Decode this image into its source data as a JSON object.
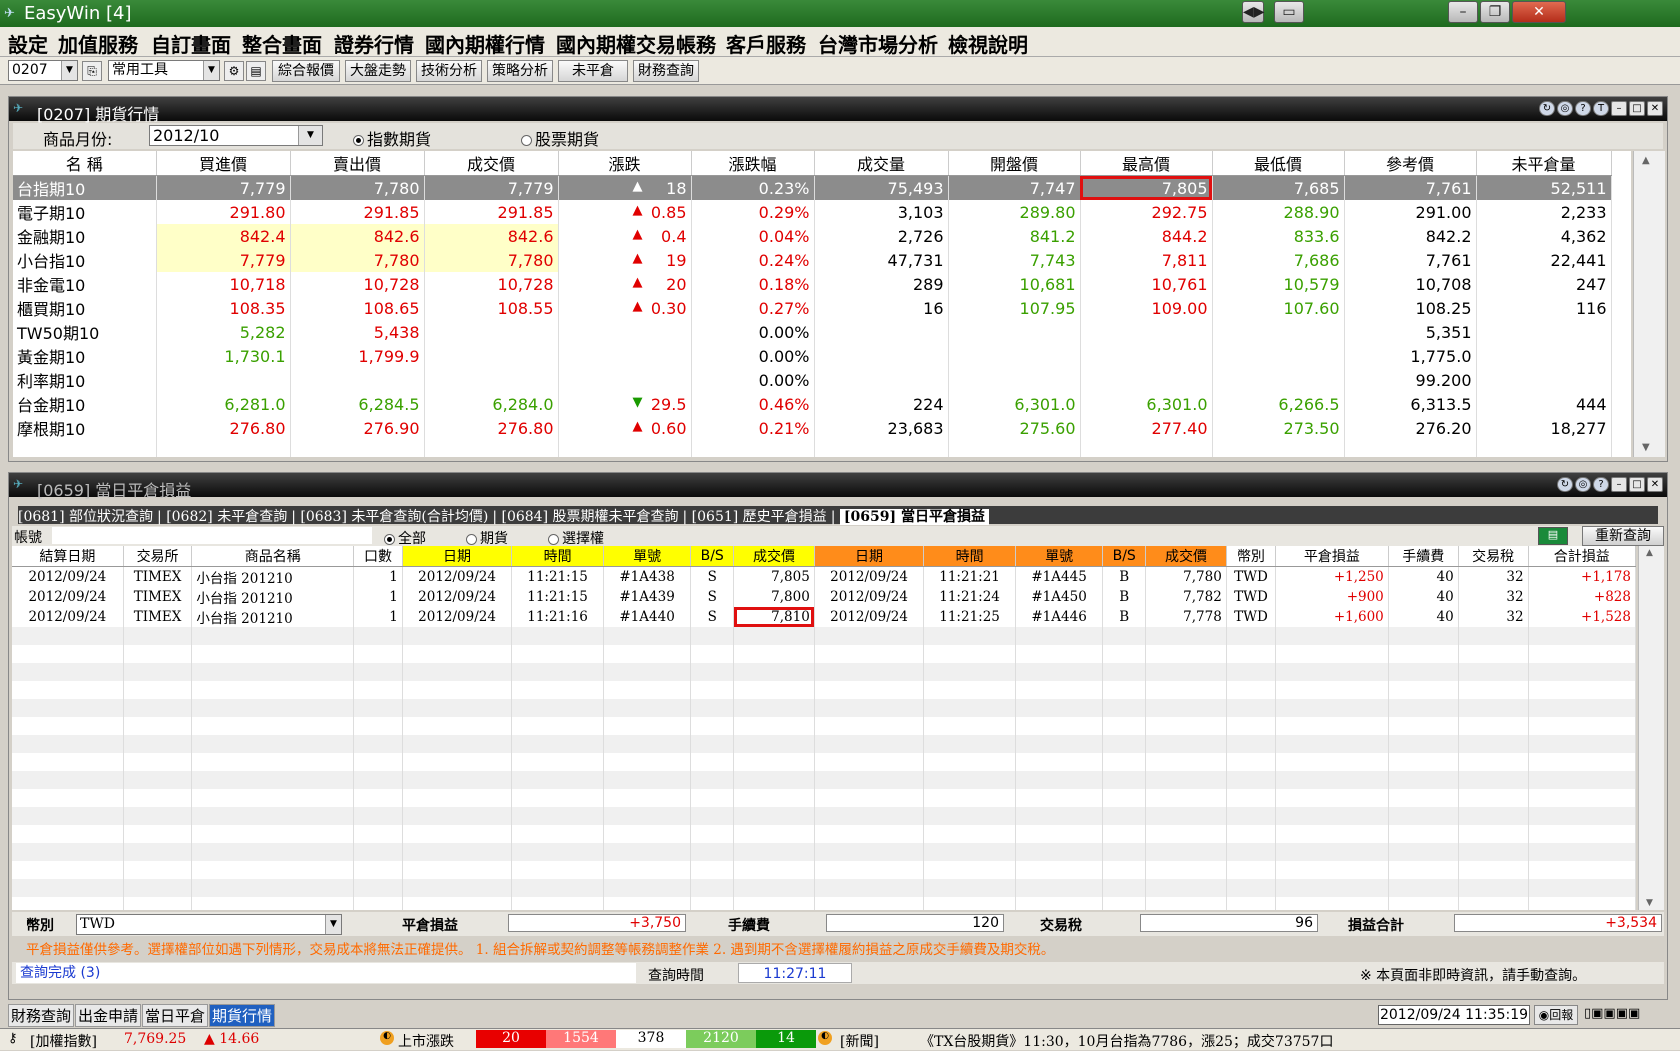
{
  "window": {
    "title": "EasyWin  [4]"
  },
  "menu": [
    "設定",
    "加值服務",
    "自訂畫面",
    "整合畫面",
    "證券行情",
    "國內期權行情",
    "國內期權交易帳務",
    "客戶服務",
    "台灣市場分析",
    "檢視說明"
  ],
  "toolbar": {
    "code": "0207",
    "tools": "常用工具",
    "buttons": [
      "綜合報價",
      "大盤走勢",
      "技術分析",
      "策略分析",
      "未平倉",
      "財務查詢"
    ]
  },
  "quote_panel": {
    "title": "[0207] 期貨行情",
    "month_label": "商品月份:",
    "month_value": "2012/10",
    "radio_index": "指數期貨",
    "radio_stock": "股票期貨",
    "columns": [
      "名 稱",
      "買進價",
      "賣出價",
      "成交價",
      "漲跌",
      "漲跌幅",
      "成交量",
      "開盤價",
      "最高價",
      "最低價",
      "參考價",
      "未平倉量"
    ],
    "rows": [
      {
        "n": "台指期10",
        "bid": "7,779",
        "ask": "7,780",
        "last": "7,779",
        "chg": "18",
        "pct": "0.23%",
        "vol": "75,493",
        "open": "7,747",
        "high": "7,805",
        "low": "7,685",
        "ref": "7,761",
        "oi": "52,511",
        "arrow": "▲"
      },
      {
        "n": "電子期10",
        "bid": "291.80",
        "ask": "291.85",
        "last": "291.85",
        "chg": "0.85",
        "pct": "0.29%",
        "vol": "3,103",
        "open": "289.80",
        "high": "292.75",
        "low": "288.90",
        "ref": "291.00",
        "oi": "2,233",
        "arrow": "▲"
      },
      {
        "n": "金融期10",
        "bid": "842.4",
        "ask": "842.6",
        "last": "842.6",
        "chg": "0.4",
        "pct": "0.04%",
        "vol": "2,726",
        "open": "841.2",
        "high": "844.2",
        "low": "833.6",
        "ref": "842.2",
        "oi": "4,362",
        "arrow": "▲"
      },
      {
        "n": "小台指10",
        "bid": "7,779",
        "ask": "7,780",
        "last": "7,780",
        "chg": "19",
        "pct": "0.24%",
        "vol": "47,731",
        "open": "7,743",
        "high": "7,811",
        "low": "7,686",
        "ref": "7,761",
        "oi": "22,441",
        "arrow": "▲"
      },
      {
        "n": "非金電10",
        "bid": "10,718",
        "ask": "10,728",
        "last": "10,728",
        "chg": "20",
        "pct": "0.18%",
        "vol": "289",
        "open": "10,681",
        "high": "10,761",
        "low": "10,579",
        "ref": "10,708",
        "oi": "247",
        "arrow": "▲"
      },
      {
        "n": "櫃買期10",
        "bid": "108.35",
        "ask": "108.65",
        "last": "108.55",
        "chg": "0.30",
        "pct": "0.27%",
        "vol": "16",
        "open": "107.95",
        "high": "109.00",
        "low": "107.60",
        "ref": "108.25",
        "oi": "116",
        "arrow": "▲"
      },
      {
        "n": "TW50期10",
        "bid": "5,282",
        "ask": "5,438",
        "last": "",
        "chg": "",
        "pct": "0.00%",
        "vol": "",
        "open": "",
        "high": "",
        "low": "",
        "ref": "5,351",
        "oi": "",
        "arrow": ""
      },
      {
        "n": "黃金期10",
        "bid": "1,730.1",
        "ask": "1,799.9",
        "last": "",
        "chg": "",
        "pct": "0.00%",
        "vol": "",
        "open": "",
        "high": "",
        "low": "",
        "ref": "1,775.0",
        "oi": "",
        "arrow": ""
      },
      {
        "n": "利率期10",
        "bid": "",
        "ask": "",
        "last": "",
        "chg": "",
        "pct": "0.00%",
        "vol": "",
        "open": "",
        "high": "",
        "low": "",
        "ref": "99.200",
        "oi": "",
        "arrow": ""
      },
      {
        "n": "台金期10",
        "bid": "6,281.0",
        "ask": "6,284.5",
        "last": "6,284.0",
        "chg": "29.5",
        "pct": "0.46%",
        "vol": "224",
        "open": "6,301.0",
        "high": "6,301.0",
        "low": "6,266.5",
        "ref": "6,313.5",
        "oi": "444",
        "arrow": "▼"
      },
      {
        "n": "摩根期10",
        "bid": "276.80",
        "ask": "276.90",
        "last": "276.80",
        "chg": "0.60",
        "pct": "0.21%",
        "vol": "23,683",
        "open": "275.60",
        "high": "277.40",
        "low": "273.50",
        "ref": "276.20",
        "oi": "18,277",
        "arrow": "▲"
      }
    ]
  },
  "pnl_panel": {
    "title": "[0659] 當日平倉損益",
    "tabs": [
      "[0681] 部位狀況查詢",
      "[0682] 未平倉查詢",
      "[0683] 未平倉查詢(合計均價)",
      "[0684] 股票期權未平倉查詢",
      "[0651] 歷史平倉損益",
      "[0659] 當日平倉損益"
    ],
    "account_label": "帳號",
    "radios": [
      "全部",
      "期貨",
      "選擇權"
    ],
    "requery": "重新查詢",
    "columns": [
      "結算日期",
      "交易所",
      "商品名稱",
      "口數",
      "日期",
      "時間",
      "單號",
      "B/S",
      "成交價",
      "日期",
      "時間",
      "單號",
      "B/S",
      "成交價",
      "幣別",
      "平倉損益",
      "手續費",
      "交易稅",
      "合計損益"
    ],
    "rows": [
      [
        "2012/09/24",
        "TIMEX",
        "小台指 201210",
        "1",
        "2012/09/24",
        "11:21:15",
        "#1A438",
        "S",
        "7,805",
        "2012/09/24",
        "11:21:21",
        "#1A445",
        "B",
        "7,780",
        "TWD",
        "+1,250",
        "40",
        "32",
        "+1,178"
      ],
      [
        "2012/09/24",
        "TIMEX",
        "小台指 201210",
        "1",
        "2012/09/24",
        "11:21:15",
        "#1A439",
        "S",
        "7,800",
        "2012/09/24",
        "11:21:24",
        "#1A450",
        "B",
        "7,782",
        "TWD",
        "+900",
        "40",
        "32",
        "+828"
      ],
      [
        "2012/09/24",
        "TIMEX",
        "小台指 201210",
        "1",
        "2012/09/24",
        "11:21:16",
        "#1A440",
        "S",
        "7,810",
        "2012/09/24",
        "11:21:25",
        "#1A446",
        "B",
        "7,778",
        "TWD",
        "+1,600",
        "40",
        "32",
        "+1,528"
      ]
    ],
    "currency_label": "幣別",
    "currency_value": "TWD",
    "sum_pnl_label": "平倉損益",
    "sum_pnl": "+3,750",
    "fee_label": "手續費",
    "fee": "120",
    "tax_label": "交易稅",
    "tax": "96",
    "total_label": "損益合計",
    "total": "+3,534",
    "notice": "平倉損益僅供參考。選擇權部位如遇下列情形，交易成本將無法正確提供。  1. 組合拆解或契約調整等帳務調整作業  2. 遇到期不含選擇權履約損益之原成交手續費及期交稅。",
    "status": "查詢完成 (3)",
    "query_time_label": "查詢時間",
    "query_time": "11:27:11",
    "realtime_note": "※ 本頁面非即時資訊，請手動查詢。"
  },
  "bottom_tabs": [
    "財務查詢",
    "出金申請",
    "當日平倉",
    "期貨行情"
  ],
  "datetime": "2012/09/24 11:35:19",
  "back_label": "回報",
  "status": {
    "index_label": "[加權指數]",
    "index_value": "7,769.25",
    "index_chg": "▲ 14.66",
    "market_label": "上市漲跌",
    "m1": "20",
    "m2": "1554",
    "m3": "378",
    "m4": "2120",
    "m5": "14",
    "news_label": "[新聞]",
    "news": "《TX台股期貨》11:30，10月台指為7786，漲25；成交73757口"
  }
}
